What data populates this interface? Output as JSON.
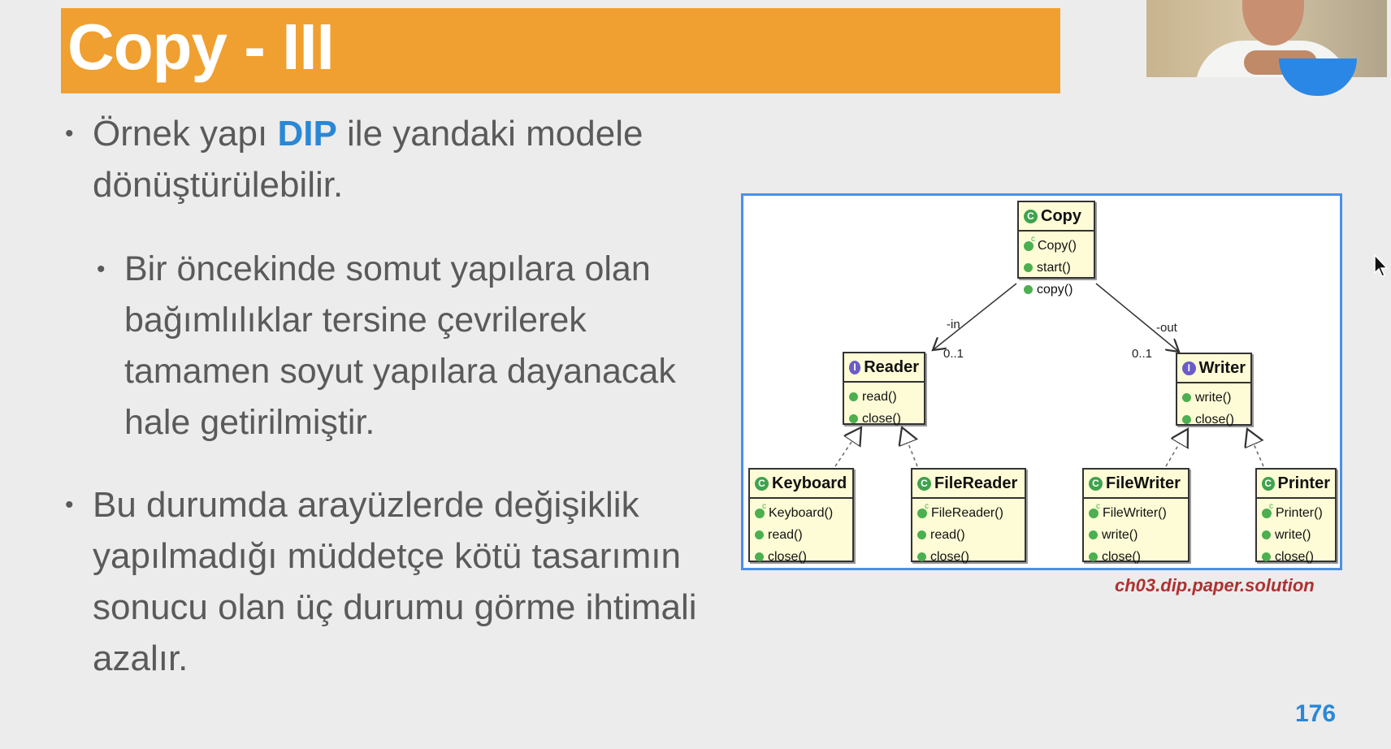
{
  "title": "Copy - III",
  "bullets": {
    "b1_pre": "Örnek yapı ",
    "b1_accent": "DIP",
    "b1_post": " ile yandaki modele dönüştürülebilir.",
    "b2": "Bir öncekinde somut yapılara olan bağımlılıklar tersine çevrilerek tamamen soyut yapılara dayanacak hale getirilmiştir.",
    "b3": "Bu durumda arayüzlerde değişiklik yapılmadığı müddetçe kötü tasarımın sonucu olan üç durumu görme ihtimali azalır.",
    "dot": "•"
  },
  "diagram": {
    "copy": {
      "name": "Copy",
      "badge": "C",
      "methods": [
        "Copy()",
        "start()",
        "copy()"
      ]
    },
    "reader": {
      "name": "Reader",
      "badge": "I",
      "methods": [
        "read()",
        "close()"
      ]
    },
    "writer": {
      "name": "Writer",
      "badge": "I",
      "methods": [
        "write()",
        "close()"
      ]
    },
    "keyboard": {
      "name": "Keyboard",
      "badge": "C",
      "methods": [
        "Keyboard()",
        "read()",
        "close()"
      ]
    },
    "filereader": {
      "name": "FileReader",
      "badge": "C",
      "methods": [
        "FileReader()",
        "read()",
        "close()"
      ]
    },
    "filewriter": {
      "name": "FileWriter",
      "badge": "C",
      "methods": [
        "FileWriter()",
        "write()",
        "close()"
      ]
    },
    "printer": {
      "name": "Printer",
      "badge": "C",
      "methods": [
        "Printer()",
        "write()",
        "close()"
      ]
    },
    "labels": {
      "in": "-in",
      "out": "-out",
      "mult_in": "0..1",
      "mult_out": "0..1"
    }
  },
  "caption": "ch03.dip.paper.solution",
  "page_number": "176",
  "colors": {
    "title_bar": "#f0a030",
    "accent": "#2a87d6",
    "caption": "#b03030",
    "diagram_border": "#4a90e8"
  }
}
